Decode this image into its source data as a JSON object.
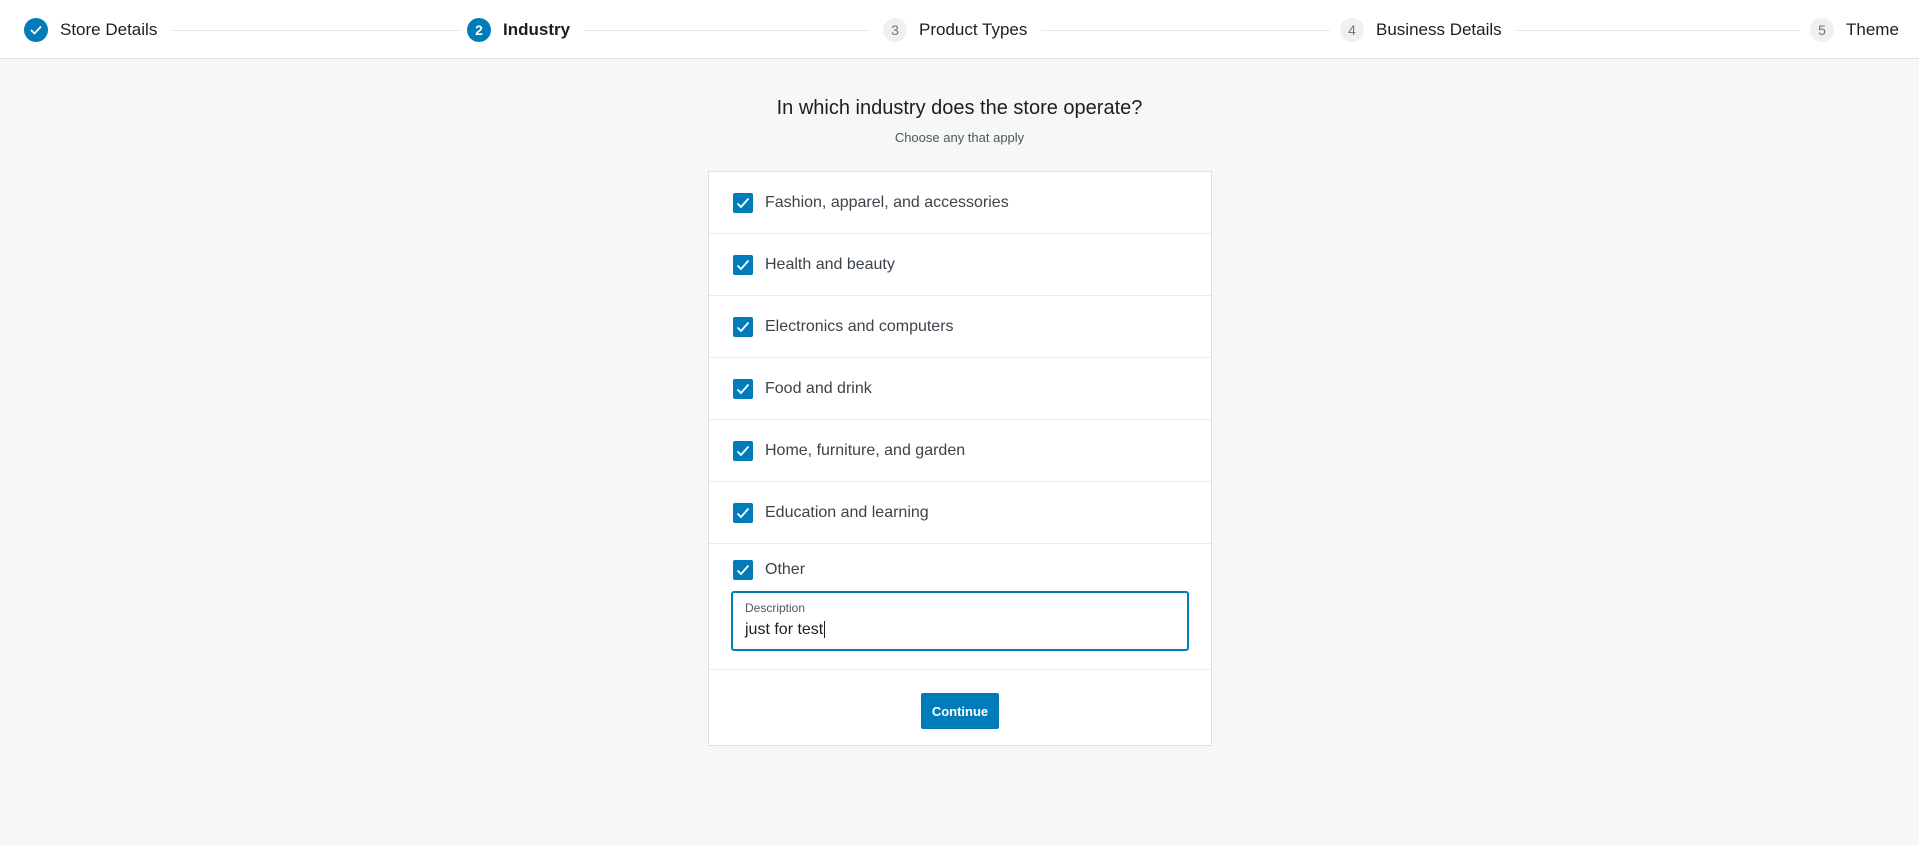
{
  "stepper": {
    "steps": [
      {
        "number": "",
        "label": "Store Details",
        "state": "complete"
      },
      {
        "number": "2",
        "label": "Industry",
        "state": "current"
      },
      {
        "number": "3",
        "label": "Product Types",
        "state": "pending"
      },
      {
        "number": "4",
        "label": "Business Details",
        "state": "pending"
      },
      {
        "number": "5",
        "label": "Theme",
        "state": "pending"
      }
    ]
  },
  "page": {
    "title": "In which industry does the store operate?",
    "subtitle": "Choose any that apply"
  },
  "industries": [
    {
      "label": "Fashion, apparel, and accessories",
      "checked": true
    },
    {
      "label": "Health and beauty",
      "checked": true
    },
    {
      "label": "Electronics and computers",
      "checked": true
    },
    {
      "label": "Food and drink",
      "checked": true
    },
    {
      "label": "Home, furniture, and garden",
      "checked": true
    },
    {
      "label": "Education and learning",
      "checked": true
    }
  ],
  "other": {
    "label": "Other",
    "checked": true,
    "description_label": "Description",
    "description_value": "just for test"
  },
  "actions": {
    "continue_label": "Continue"
  },
  "colors": {
    "accent": "#007cba",
    "background": "#f6f7f7"
  }
}
